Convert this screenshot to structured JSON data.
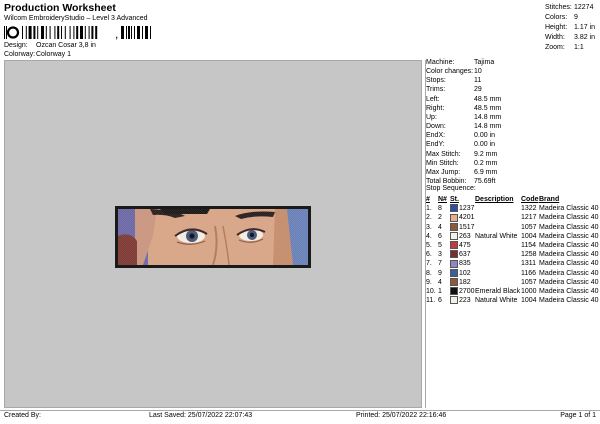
{
  "header": {
    "title": "Production Worksheet",
    "subtitle": "Wilcom EmbroideryStudio – Level 3 Advanced",
    "barcode_char": ","
  },
  "design_info": {
    "design_label": "Design:",
    "design_value": "Ozcan Cosar 3,8 in",
    "colorway_label": "Colorway:",
    "colorway_value": "Colorway 1"
  },
  "top_stats": [
    {
      "label": "Stitches:",
      "value": "12274"
    },
    {
      "label": "Colors:",
      "value": "9"
    },
    {
      "label": "Height:",
      "value": "1.17 in"
    },
    {
      "label": "Width:",
      "value": "3.82 in"
    },
    {
      "label": "Zoom:",
      "value": "1:1"
    }
  ],
  "machine_info": [
    {
      "label": "Machine:",
      "value": "Tajima"
    },
    {
      "label": "Color changes:",
      "value": "10"
    },
    {
      "label": "Stops:",
      "value": "11"
    },
    {
      "label": "Trims:",
      "value": "29"
    },
    {
      "label": "Left:",
      "value": "48.5 mm"
    },
    {
      "label": "Right:",
      "value": "48.5 mm"
    },
    {
      "label": "Up:",
      "value": "14.8 mm"
    },
    {
      "label": "Down:",
      "value": "14.8 mm"
    },
    {
      "label": "EndX:",
      "value": "0.00 in"
    },
    {
      "label": "EndY:",
      "value": "0.00 in"
    },
    {
      "label": "Max Stitch:",
      "value": "9.2 mm"
    },
    {
      "label": "Min Stitch:",
      "value": "0.2 mm"
    },
    {
      "label": "Max Jump:",
      "value": "6.9 mm"
    },
    {
      "label": "Total Bobbin:",
      "value": "75.69ft"
    }
  ],
  "stop_sequence": {
    "label": "Stop Sequence:",
    "headers": [
      "#",
      "N#",
      "St.",
      "Description",
      "Code",
      "Brand"
    ],
    "rows": [
      {
        "num": "1.",
        "n": "8",
        "color": "#2f4fa0",
        "st": "1237",
        "desc": "",
        "code": "1322",
        "brand": "Madeira Classic 40"
      },
      {
        "num": "2.",
        "n": "2",
        "color": "#e8b08a",
        "st": "4201",
        "desc": "",
        "code": "1217",
        "brand": "Madeira Classic 40"
      },
      {
        "num": "3.",
        "n": "4",
        "color": "#8a5a3a",
        "st": "1517",
        "desc": "",
        "code": "1057",
        "brand": "Madeira Classic 40"
      },
      {
        "num": "4.",
        "n": "6",
        "color": "#f4f1e8",
        "st": "263",
        "desc": "Natural White",
        "code": "1004",
        "brand": "Madeira Classic 40"
      },
      {
        "num": "5.",
        "n": "5",
        "color": "#c23a3a",
        "st": "475",
        "desc": "",
        "code": "1154",
        "brand": "Madeira Classic 40"
      },
      {
        "num": "6.",
        "n": "3",
        "color": "#7a2e2e",
        "st": "637",
        "desc": "",
        "code": "1258",
        "brand": "Madeira Classic 40"
      },
      {
        "num": "7.",
        "n": "7",
        "color": "#8f86c4",
        "st": "835",
        "desc": "",
        "code": "1311",
        "brand": "Madeira Classic 40"
      },
      {
        "num": "8.",
        "n": "9",
        "color": "#3a5f9e",
        "st": "102",
        "desc": "",
        "code": "1166",
        "brand": "Madeira Classic 40"
      },
      {
        "num": "9.",
        "n": "4",
        "color": "#8a5a3a",
        "st": "182",
        "desc": "",
        "code": "1057",
        "brand": "Madeira Classic 40"
      },
      {
        "num": "10.",
        "n": "1",
        "color": "#111111",
        "st": "2700",
        "desc": "Emerald Black",
        "code": "1000",
        "brand": "Madeira Classic 40"
      },
      {
        "num": "11.",
        "n": "6",
        "color": "#f4f1e8",
        "st": "223",
        "desc": "Natural White",
        "code": "1004",
        "brand": "Madeira Classic 40"
      }
    ]
  },
  "footer": {
    "created_by": "Created By:",
    "last_saved": "Last Saved: 25/07/2022 22:07:43",
    "printed": "Printed: 25/07/2022 22:16:46",
    "page": "Page 1 of 1"
  }
}
